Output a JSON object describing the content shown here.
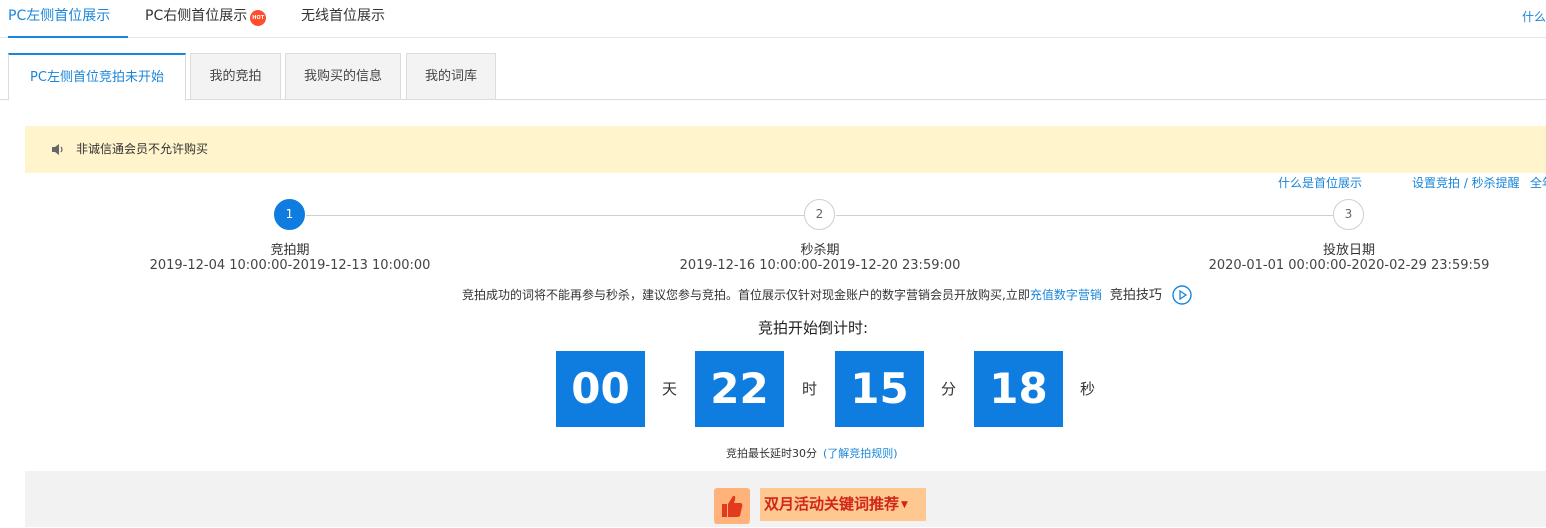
{
  "top_tabs": [
    {
      "label": "PC左侧首位展示",
      "active": true
    },
    {
      "label": "PC右侧首位展示",
      "hot": "HOT"
    },
    {
      "label": "无线首位展示"
    }
  ],
  "top_right_link": "什么",
  "sub_tabs": [
    {
      "label": "PC左侧首位竞拍未开始",
      "active": true
    },
    {
      "label": "我的竞拍"
    },
    {
      "label": "我购买的信息"
    },
    {
      "label": "我的词库"
    }
  ],
  "notice": {
    "text": "非诚信通会员不允许购买"
  },
  "help_links": [
    "什么是首位展示",
    "设置竞拍 / 秒杀提醒",
    "全年"
  ],
  "steps": [
    {
      "num": "1",
      "title": "竞拍期",
      "date": "2019-12-04 10:00:00-2019-12-13 10:00:00",
      "active": true
    },
    {
      "num": "2",
      "title": "秒杀期",
      "date": "2019-12-16 10:00:00-2019-12-20 23:59:00"
    },
    {
      "num": "3",
      "title": "投放日期",
      "date": "2020-01-01 00:00:00-2020-02-29 23:59:59"
    }
  ],
  "advice": {
    "text": "竞拍成功的词将不能再参与秒杀，建议您参与竞拍。首位展示仅针对现金账户的数字营销会员开放购买,立即",
    "link": "充值数字营销",
    "tips": "竞拍技巧"
  },
  "countdown": {
    "title": "竞拍开始倒计时:",
    "days": "00",
    "days_unit": "天",
    "hours": "22",
    "hours_unit": "时",
    "minutes": "15",
    "minutes_unit": "分",
    "seconds": "18",
    "seconds_unit": "秒"
  },
  "delay": {
    "text": "竞拍最长延时30分",
    "link": "(了解竞拍规则)"
  },
  "promo": {
    "label": "双月活动关键词推荐",
    "caret": "▼"
  },
  "colors": {
    "accent": "#0f7de0",
    "link": "#1a86d9",
    "notice_bg": "#fff4cc"
  }
}
